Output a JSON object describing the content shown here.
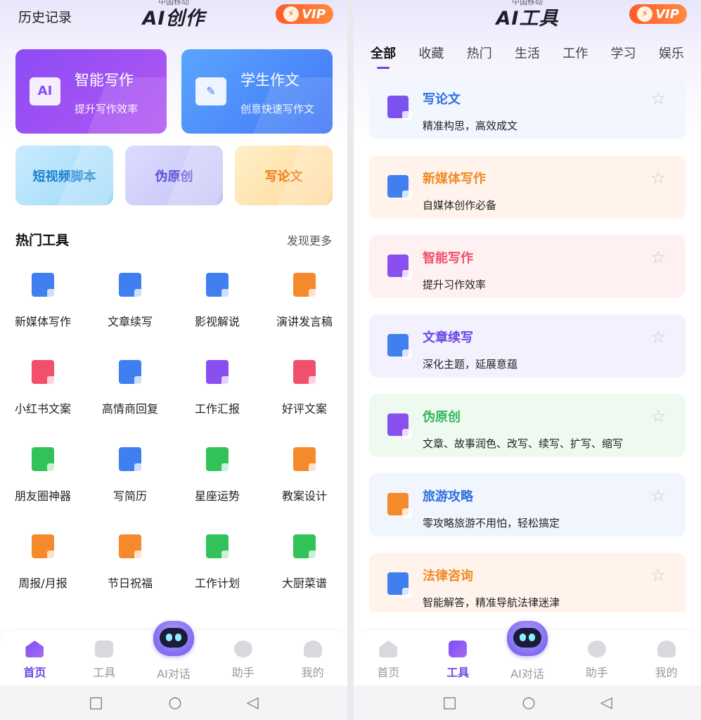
{
  "left_screen": {
    "status_carrier": "中国移动",
    "header": {
      "history": "历史记录",
      "title": "AI创作",
      "vip": "VIP"
    },
    "feature_cards": [
      {
        "title": "智能写作",
        "subtitle": "提升写作效率",
        "icon": "ai-document-icon"
      },
      {
        "title": "学生作文",
        "subtitle": "创意快速写作文",
        "icon": "essay-feather-icon"
      }
    ],
    "small_cards": [
      "短视频脚本",
      "伪原创",
      "写论文"
    ],
    "hot_tools": {
      "title": "热门工具",
      "more": "发现更多",
      "items": [
        {
          "label": "新媒体写作",
          "color": "#3f7ff0"
        },
        {
          "label": "文章续写",
          "color": "#3f7ff0"
        },
        {
          "label": "影视解说",
          "color": "#3f7ff0"
        },
        {
          "label": "演讲发言稿",
          "color": "#f58a2c"
        },
        {
          "label": "小红书文案",
          "color": "#f0506b"
        },
        {
          "label": "高情商回复",
          "color": "#3f7ff0"
        },
        {
          "label": "工作汇报",
          "color": "#8a4ff0"
        },
        {
          "label": "好评文案",
          "color": "#f0506b"
        },
        {
          "label": "朋友圈神器",
          "color": "#33c25a"
        },
        {
          "label": "写简历",
          "color": "#3f7ff0"
        },
        {
          "label": "星座运势",
          "color": "#33c25a"
        },
        {
          "label": "教案设计",
          "color": "#f58a2c"
        },
        {
          "label": "周报/月报",
          "color": "#f58a2c"
        },
        {
          "label": "节日祝福",
          "color": "#f58a2c"
        },
        {
          "label": "工作计划",
          "color": "#33c25a"
        },
        {
          "label": "大厨菜谱",
          "color": "#33c25a"
        }
      ]
    },
    "nav": [
      "首页",
      "工具",
      "AI对话",
      "助手",
      "我的"
    ],
    "active_nav": "首页"
  },
  "right_screen": {
    "status_carrier": "中国移动",
    "header": {
      "title": "AI工具",
      "vip": "VIP"
    },
    "tabs": [
      "全部",
      "收藏",
      "热门",
      "生活",
      "工作",
      "学习",
      "娱乐"
    ],
    "active_tab": "全部",
    "tools": [
      {
        "title": "写论文",
        "desc": "精准构思，高效成文",
        "title_color": "#2f6fe0",
        "bg": "#f2f6fe",
        "icon_color": "#7b52f0"
      },
      {
        "title": "新媒体写作",
        "desc": "自媒体创作必备",
        "title_color": "#f08a24",
        "bg": "#fff3ec",
        "icon_color": "#3f7ff0"
      },
      {
        "title": "智能写作",
        "desc": "提升习作效率",
        "title_color": "#ee4f6a",
        "bg": "#fff1f1",
        "icon_color": "#8a4ff0"
      },
      {
        "title": "文章续写",
        "desc": "深化主题，延展意蕴",
        "title_color": "#6a45e6",
        "bg": "#f3f1fe",
        "icon_color": "#3f7ff0"
      },
      {
        "title": "伪原创",
        "desc": "文章、故事润色、改写、续写、扩写、缩写",
        "title_color": "#2fb85a",
        "bg": "#eefaf0",
        "icon_color": "#8a4ff0"
      },
      {
        "title": "旅游攻略",
        "desc": "零攻略旅游不用怕，轻松搞定",
        "title_color": "#2f6fe0",
        "bg": "#f1f5fe",
        "icon_color": "#f58a2c"
      },
      {
        "title": "法律咨询",
        "desc": "智能解答，精准导航法律迷津",
        "title_color": "#f08a24",
        "bg": "#fff3ec",
        "icon_color": "#3f7ff0"
      }
    ],
    "nav": [
      "首页",
      "工具",
      "AI对话",
      "助手",
      "我的"
    ],
    "active_nav": "工具"
  },
  "system_bar": {
    "back": "◁",
    "home": "○",
    "recent": "□"
  }
}
